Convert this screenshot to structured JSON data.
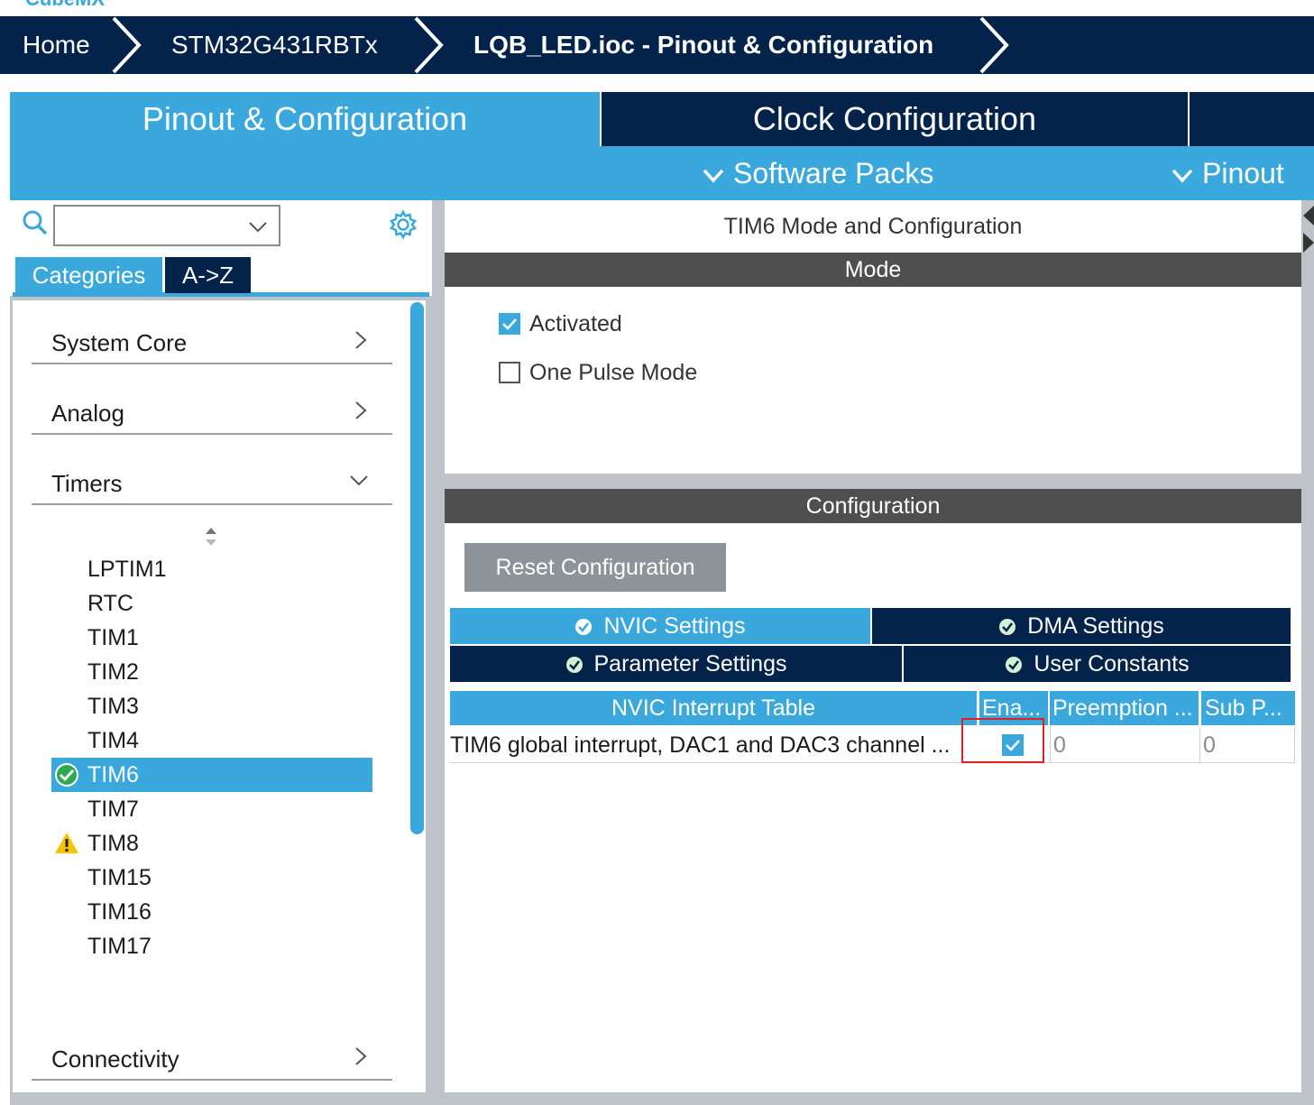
{
  "app": {
    "logo_text": "CubeMX"
  },
  "breadcrumb": {
    "home": "Home",
    "device": "STM32G431RBTx",
    "project": "LQB_LED.ioc - Pinout & Configuration"
  },
  "main_tabs": {
    "pinout": "Pinout & Configuration",
    "clock": "Clock Configuration"
  },
  "subbar": {
    "software_packs": "Software Packs",
    "pinout": "Pinout"
  },
  "search": {
    "value": ""
  },
  "category_tabs": {
    "categories": "Categories",
    "az": "A->Z"
  },
  "categories": {
    "system_core": "System Core",
    "analog": "Analog",
    "timers": "Timers",
    "connectivity": "Connectivity"
  },
  "timers": [
    "LPTIM1",
    "RTC",
    "TIM1",
    "TIM2",
    "TIM3",
    "TIM4",
    "TIM6",
    "TIM7",
    "TIM8",
    "TIM15",
    "TIM16",
    "TIM17"
  ],
  "timer_status": {
    "selected": "TIM6",
    "warning": "TIM8"
  },
  "panel": {
    "title": "TIM6 Mode and Configuration",
    "mode_header": "Mode",
    "activated": "Activated",
    "activated_checked": true,
    "one_pulse": "One Pulse Mode",
    "one_pulse_checked": false,
    "config_header": "Configuration",
    "reset_button": "Reset Configuration"
  },
  "config_tabs": {
    "nvic": "NVIC Settings",
    "dma": "DMA Settings",
    "param": "Parameter Settings",
    "user": "User Constants"
  },
  "nvic_table": {
    "headers": [
      "NVIC Interrupt Table",
      "Ena...",
      "Preemption ...",
      "Sub P..."
    ],
    "rows": [
      {
        "name": "TIM6 global interrupt, DAC1 and DAC3 channel ...",
        "enabled": true,
        "preemption": "0",
        "sub": "0"
      }
    ]
  },
  "colors": {
    "accent": "#3aa8dd",
    "navy": "#03234b",
    "section": "#4f4f4f",
    "warning": "#f5c400",
    "highlight": "#e02020"
  }
}
